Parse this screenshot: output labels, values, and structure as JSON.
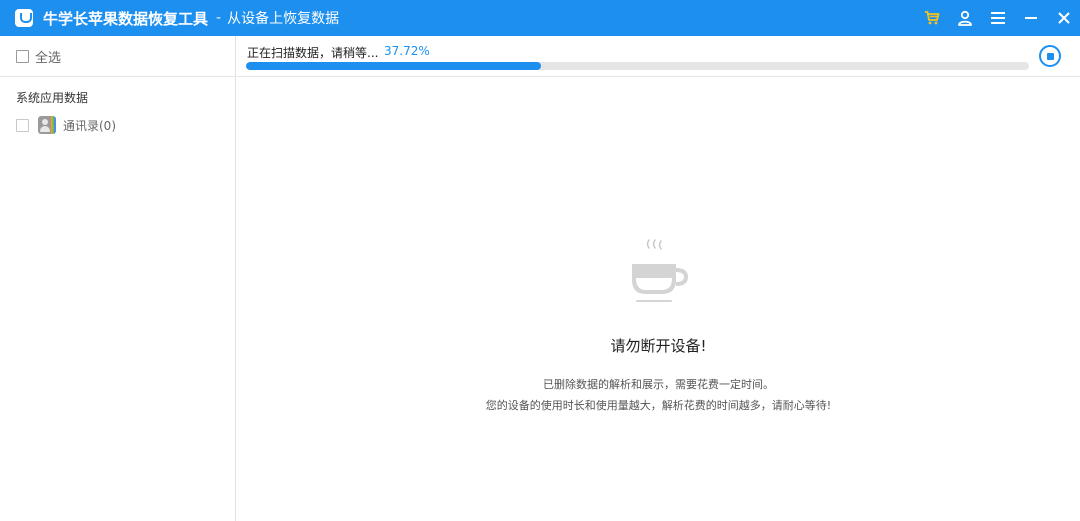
{
  "window": {
    "app_title": "牛学长苹果数据恢复工具",
    "separator": "-",
    "subtitle": "从设备上恢复数据"
  },
  "sidebar": {
    "select_all_label": "全选",
    "group_label": "系统应用数据",
    "items": [
      {
        "label": "通讯录(0)",
        "icon": "contacts-icon"
      }
    ]
  },
  "scan": {
    "status_text": "正在扫描数据，请稍等...",
    "percent_text": "37.72%",
    "progress": 0.3772
  },
  "main": {
    "warning_title": "请勿断开设备!",
    "description_line1": "已删除数据的解析和展示，需要花费一定时间。",
    "description_line2": "您的设备的使用时长和使用量越大，解析花费的时间越多，请耐心等待!"
  },
  "colors": {
    "accent": "#1c8fef",
    "cart_icon": "#f7c31a"
  }
}
